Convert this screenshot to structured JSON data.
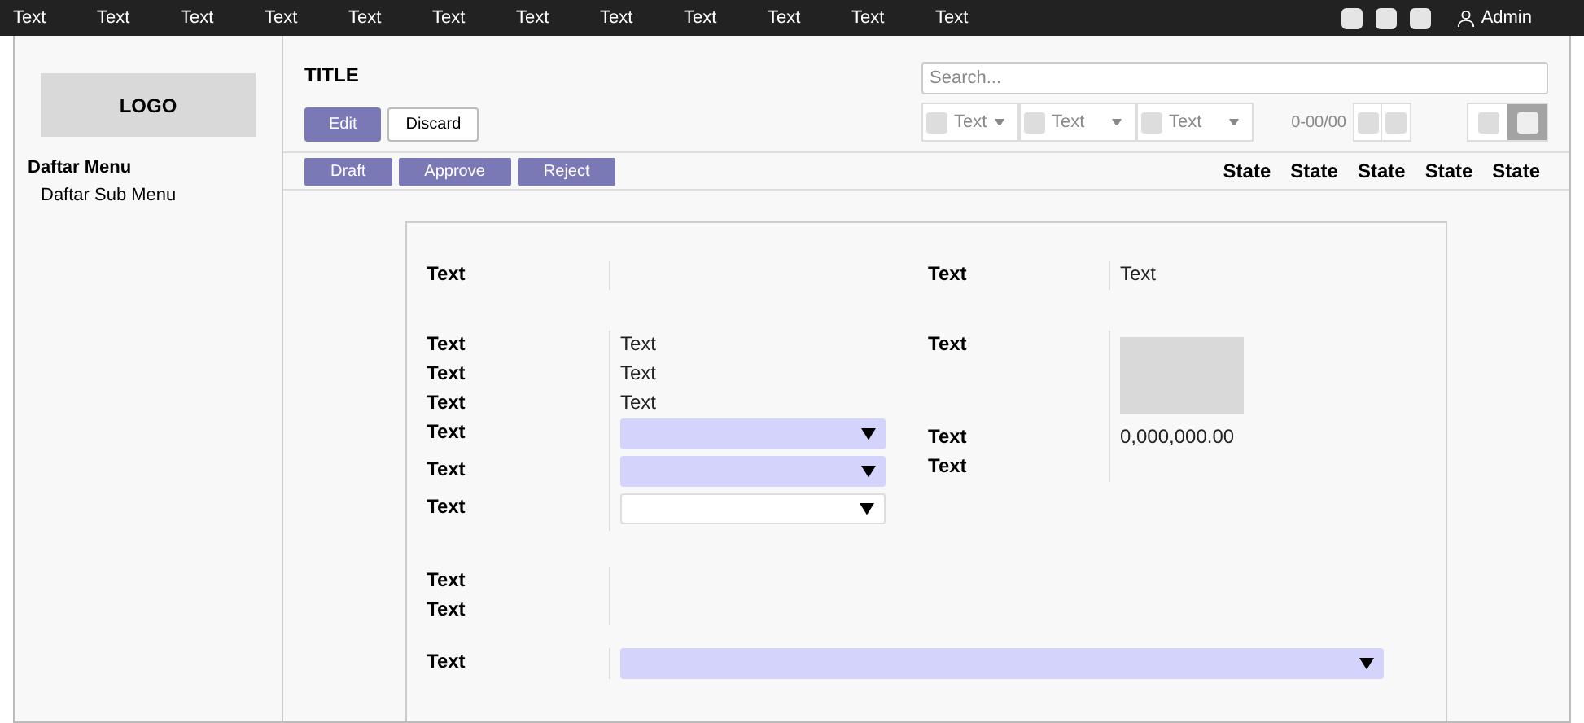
{
  "topbar": {
    "menu": [
      "Text",
      "Text",
      "Text",
      "Text",
      "Text",
      "Text",
      "Text",
      "Text",
      "Text",
      "Text",
      "Text",
      "Text"
    ],
    "user": "Admin"
  },
  "sidebar": {
    "logo": "LOGO",
    "menu": [
      {
        "label": "Daftar Menu",
        "children": [
          {
            "label": "Daftar Sub Menu"
          }
        ]
      }
    ]
  },
  "header": {
    "title": "TITLE",
    "buttons": [
      {
        "label": "Edit",
        "kind": "primary"
      },
      {
        "label": "Discard",
        "kind": "secondary"
      }
    ],
    "search": {
      "placeholder": "Search..."
    },
    "filters": [
      "Text",
      "Text",
      "Text"
    ],
    "pager": "0-00/00",
    "views": [
      {
        "selected": false
      },
      {
        "selected": true
      }
    ]
  },
  "statusbar": {
    "actions": [
      "Draft",
      "Approve",
      "Reject"
    ],
    "states": [
      "State",
      "State",
      "State",
      "State",
      "State"
    ]
  },
  "form": {
    "sections": [
      {
        "left": [
          {
            "label": "Text"
          }
        ],
        "right": [
          {
            "label": "Text",
            "value": {
              "kind": "text",
              "text": "Text"
            }
          }
        ]
      },
      {
        "left": [
          {
            "label": "Text",
            "value": {
              "kind": "text",
              "text": "Text"
            }
          },
          {
            "label": "Text",
            "value": {
              "kind": "text",
              "text": "Text"
            }
          },
          {
            "label": "Text",
            "value": {
              "kind": "text",
              "text": "Text"
            }
          },
          {
            "label": "Text",
            "value": {
              "kind": "select",
              "filled": true
            }
          },
          {
            "label": "Text",
            "value": {
              "kind": "select",
              "filled": true
            }
          },
          {
            "label": "Text",
            "value": {
              "kind": "select",
              "filled": false
            }
          }
        ],
        "right": [
          {
            "label": "Text",
            "value": {
              "kind": "image"
            }
          },
          {
            "label": "Text",
            "value": {
              "kind": "text",
              "text": "0,000,000.00"
            }
          },
          {
            "label": "Text"
          }
        ]
      },
      {
        "left": [
          {
            "label": "Text"
          },
          {
            "label": "Text"
          }
        ]
      },
      {
        "full": {
          "label": "Text",
          "value": {
            "kind": "select",
            "filled": true
          }
        }
      }
    ]
  }
}
